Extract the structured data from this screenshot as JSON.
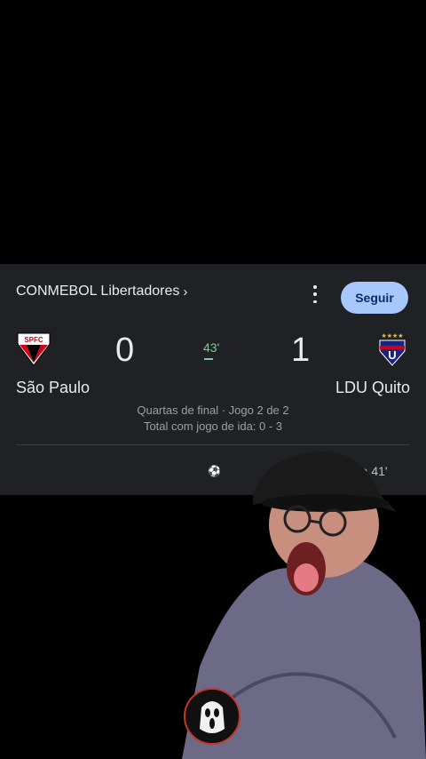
{
  "competition": {
    "name": "CONMEBOL Libertadores",
    "chevron": "›"
  },
  "follow_button": {
    "label": "Seguir"
  },
  "menu": {
    "icon": "more-vert-icon"
  },
  "match": {
    "home": {
      "name": "São Paulo",
      "score": "0",
      "crest_text": "SPFC"
    },
    "away": {
      "name": "LDU Quito",
      "score": "1",
      "crest_text": "U"
    },
    "minute": "43'",
    "stage": "Quartas de final · Jogo 2 de 2",
    "aggregate": "Total com jogo de ida: 0 - 3"
  },
  "event": {
    "icon": "soccer-ball-icon",
    "text": "dina 41'"
  },
  "colors": {
    "card": "#202124",
    "follow": "#a8c7fa",
    "live_minute": "#81c995"
  }
}
